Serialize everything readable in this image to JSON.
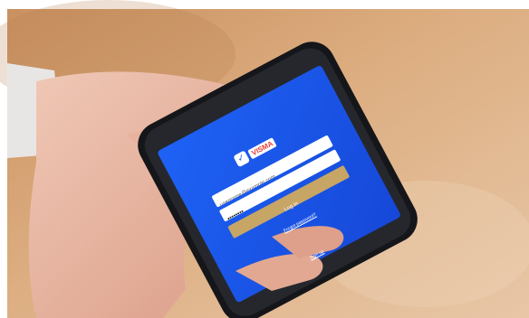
{
  "photo": {
    "scene": "hand holding smartphone over wooden table",
    "background_color": "#d9a26f",
    "sleeve_color": "#e8e6e4",
    "skin_color": "#e9b6a0",
    "phone_body_color": "#15161a"
  },
  "phone_screen": {
    "background_color": "#1b5cf2",
    "logo": {
      "icon": "checkmark-shield-icon",
      "text": "VISMA",
      "accent_color": "#e53935"
    },
    "email_field": {
      "value": "username@example.com"
    },
    "password_field": {
      "value": "••••••••"
    },
    "login_button": {
      "label": "Log in",
      "color": "#c7a565"
    },
    "forgot_password_link": {
      "label": "Forgot password?"
    },
    "footer_link": {
      "label": "Sign up"
    }
  }
}
